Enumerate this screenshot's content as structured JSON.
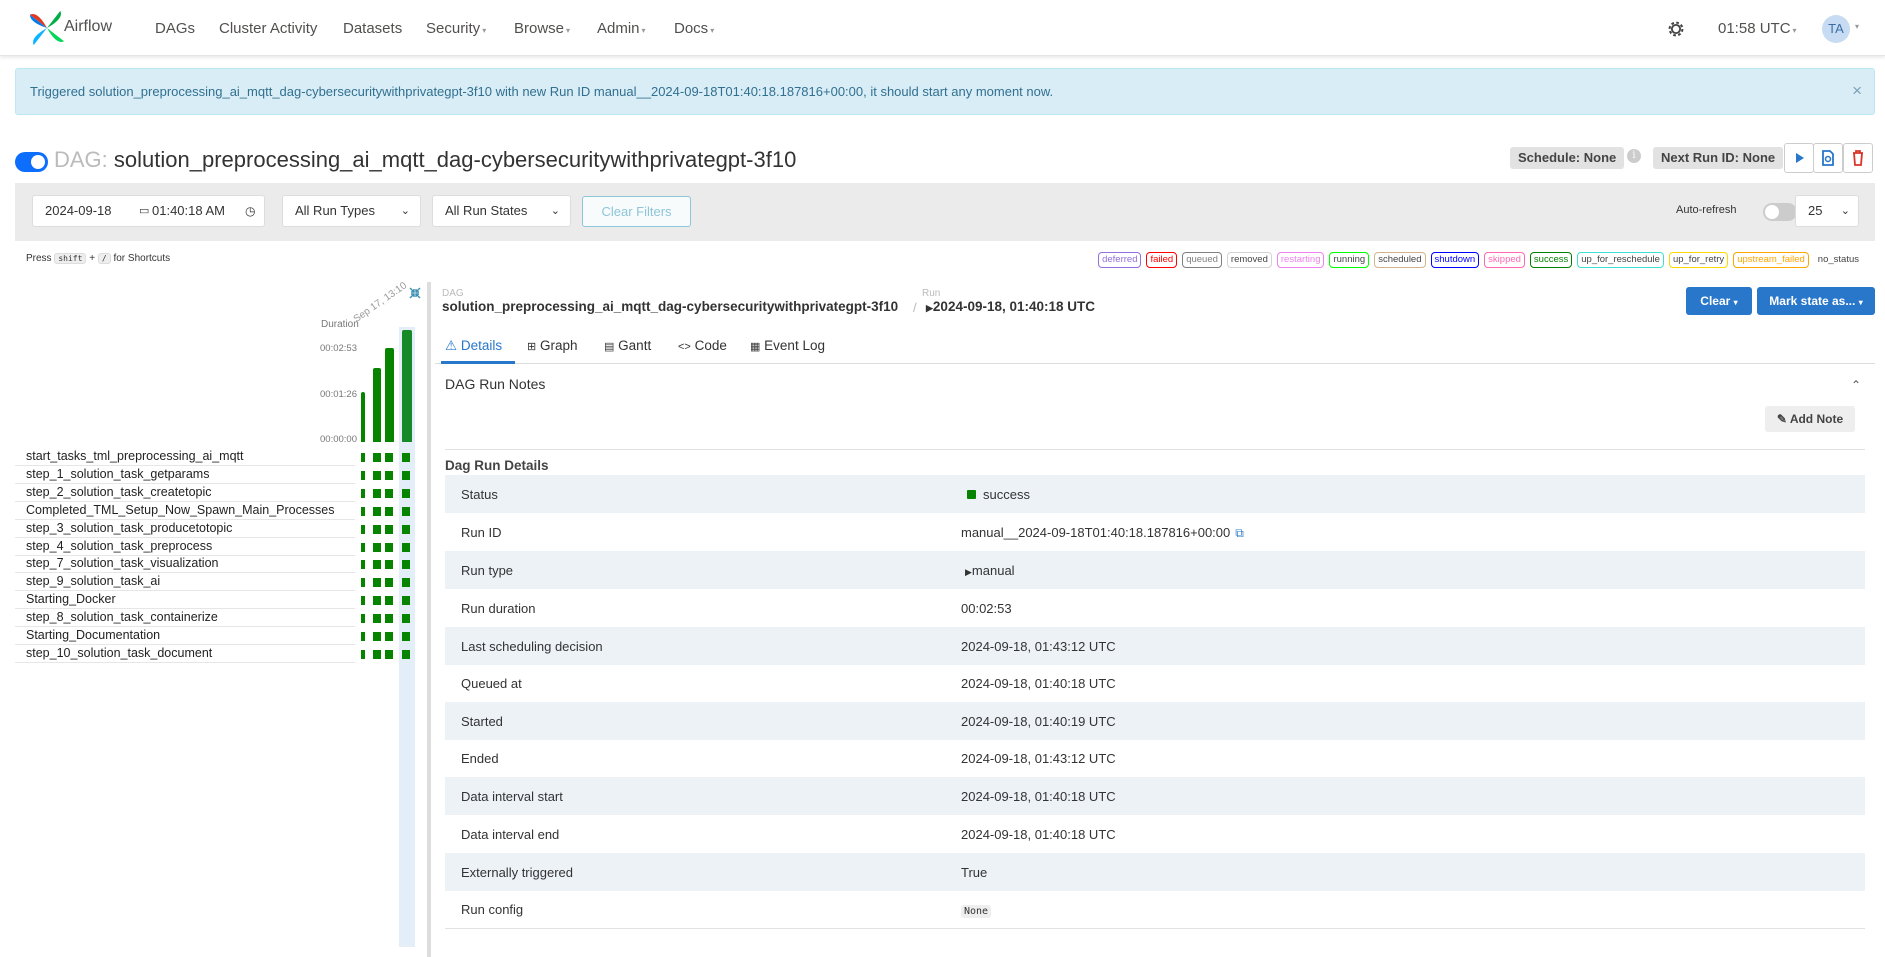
{
  "nav": {
    "brand": "Airflow",
    "items": [
      "DAGs",
      "Cluster Activity",
      "Datasets",
      "Security",
      "Browse",
      "Admin",
      "Docs"
    ],
    "time": "01:58 UTC",
    "user_initials": "TA"
  },
  "alert": {
    "message": "Triggered solution_preprocessing_ai_mqtt_dag-cybersecuritywithprivategpt-3f10 with new Run ID manual__2024-09-18T01:40:18.187816+00:00, it should start any moment now.",
    "close": "×"
  },
  "dag": {
    "prefix": "DAG:",
    "id": "solution_preprocessing_ai_mqtt_dag-cybersecuritywithprivategpt-3f10",
    "schedule": "Schedule: None",
    "info": "i",
    "next_run": "Next Run ID: None"
  },
  "filters": {
    "date": "2024-09-18",
    "time": "01:40:18 AM",
    "run_types": "All Run Types",
    "run_states": "All Run States",
    "clear": "Clear Filters",
    "auto_refresh": "Auto-refresh",
    "page_size": "25"
  },
  "shortcuts": {
    "press": "Press",
    "key1": "shift",
    "plus": "+",
    "key2": "/",
    "suffix": "for Shortcuts"
  },
  "legend": [
    {
      "label": "deferred",
      "color": "#9370db"
    },
    {
      "label": "failed",
      "color": "#ff0000"
    },
    {
      "label": "queued",
      "color": "#808080"
    },
    {
      "label": "removed",
      "color": "#d3d3d3"
    },
    {
      "label": "restarting",
      "color": "#ee82ee"
    },
    {
      "label": "running",
      "color": "#00ff00"
    },
    {
      "label": "scheduled",
      "color": "#d2b48c"
    },
    {
      "label": "shutdown",
      "color": "#0000ff"
    },
    {
      "label": "skipped",
      "color": "#ff69b4"
    },
    {
      "label": "success",
      "color": "#008000"
    },
    {
      "label": "up_for_reschedule",
      "color": "#40e0d0"
    },
    {
      "label": "up_for_retry",
      "color": "#ffd700"
    },
    {
      "label": "upstream_failed",
      "color": "#ffa500"
    },
    {
      "label": "no_status",
      "color": "#ffffff"
    }
  ],
  "grid": {
    "duration_label": "Duration",
    "date_label": "Sep 17, 13:10",
    "ticks": [
      "00:02:53",
      "00:01:26",
      "00:00:00"
    ],
    "runs": [
      {
        "duration": 78
      },
      {
        "duration": 115
      },
      {
        "duration": 145
      },
      {
        "duration": 173
      }
    ],
    "tasks": [
      "start_tasks_tml_preprocessing_ai_mqtt",
      "step_1_solution_task_getparams",
      "step_2_solution_task_createtopic",
      "Completed_TML_Setup_Now_Spawn_Main_Processes",
      "step_3_solution_task_producetotopic",
      "step_4_solution_task_preprocess",
      "step_7_solution_task_visualization",
      "step_9_solution_task_ai",
      "Starting_Docker",
      "step_8_solution_task_containerize",
      "Starting_Documentation",
      "step_10_solution_task_document"
    ],
    "status_color": "#068400"
  },
  "breadcrumb": {
    "dag_label": "DAG",
    "dag_id": "solution_preprocessing_ai_mqtt_dag-cybersecuritywithprivategpt-3f10",
    "sep": "/",
    "run_label": "Run",
    "run": "2024-09-18, 01:40:18 UTC"
  },
  "actions": {
    "clear": "Clear",
    "mark_state": "Mark state as..."
  },
  "tabs": [
    "Details",
    "Graph",
    "Gantt",
    "Code",
    "Event Log"
  ],
  "notes": {
    "title": "DAG Run Notes",
    "add": "Add Note"
  },
  "details": {
    "title": "Dag Run Details",
    "rows": [
      {
        "key": "Status",
        "value": "success"
      },
      {
        "key": "Run ID",
        "value": "manual__2024-09-18T01:40:18.187816+00:00"
      },
      {
        "key": "Run type",
        "value": "manual"
      },
      {
        "key": "Run duration",
        "value": "00:02:53"
      },
      {
        "key": "Last scheduling decision",
        "value": "2024-09-18, 01:43:12 UTC"
      },
      {
        "key": "Queued at",
        "value": "2024-09-18, 01:40:18 UTC"
      },
      {
        "key": "Started",
        "value": "2024-09-18, 01:40:19 UTC"
      },
      {
        "key": "Ended",
        "value": "2024-09-18, 01:43:12 UTC"
      },
      {
        "key": "Data interval start",
        "value": "2024-09-18, 01:40:18 UTC"
      },
      {
        "key": "Data interval end",
        "value": "2024-09-18, 01:40:18 UTC"
      },
      {
        "key": "Externally triggered",
        "value": "True"
      },
      {
        "key": "Run config",
        "value": "None"
      }
    ]
  }
}
